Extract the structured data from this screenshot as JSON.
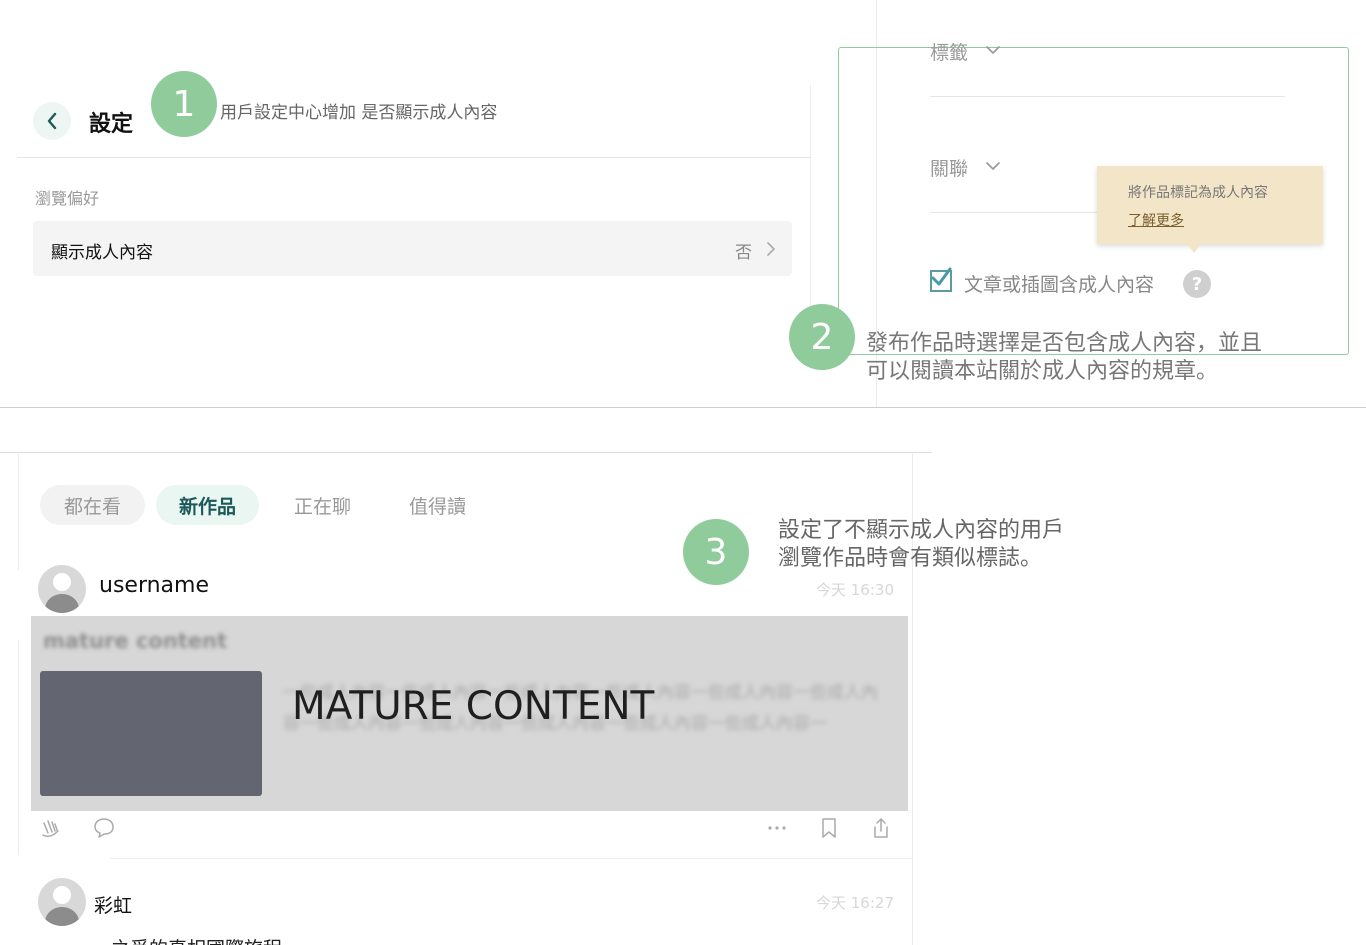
{
  "panel1": {
    "title": "設定",
    "badge": "1",
    "note": "用戶設定中心增加 是否顯示成人內容",
    "section_label": "瀏覽偏好",
    "row_label": "顯示成人內容",
    "row_value": "否"
  },
  "panel2": {
    "tag_label": "標籤",
    "relation_label": "關聯",
    "tooltip_text": "將作品標記為成人內容",
    "tooltip_link": "了解更多",
    "checkbox_label": "文章或插圖含成人內容",
    "checkbox_checked": true,
    "help_icon": "?",
    "badge": "2",
    "note_line1": "發布作品時選擇是否包含成人內容，並且",
    "note_line2": "可以閱讀本站關於成人內容的規章。"
  },
  "panel3": {
    "tabs": [
      {
        "label": "都在看",
        "active": false
      },
      {
        "label": "新作品",
        "active": true
      },
      {
        "label": "正在聊",
        "active": false
      },
      {
        "label": "值得讀",
        "active": false
      }
    ],
    "badge": "3",
    "note_line1": "設定了不顯示成人內容的用戶",
    "note_line2": "瀏覽作品時會有類似標誌。",
    "post1": {
      "username": "username",
      "time": "今天 16:30",
      "blurred_title": "mature content",
      "blurred_body": "一些成人內容一些成人內容一些成人內容一些成人內容一些成人內容一些成人內容一些成人內容一些成人內容一些成人內容一些成人內容一些成人內容一",
      "overlay_label": "MATURE CONTENT"
    },
    "post2": {
      "username": "彩虹",
      "time": "今天 16:27",
      "body_partial": "之爭的真相國際旅程"
    }
  },
  "colors": {
    "badge_green": "#8fcb9b",
    "active_tab_text": "#1c5a5a",
    "tooltip_bg": "#f3e5c8"
  }
}
